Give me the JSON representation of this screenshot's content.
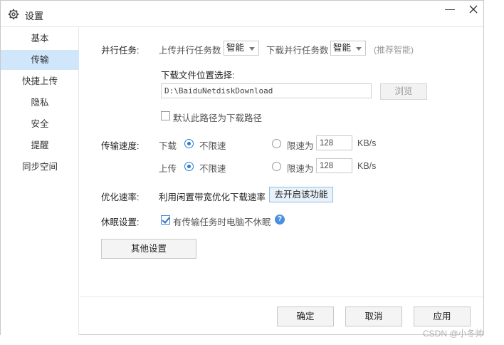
{
  "window": {
    "title": "设置"
  },
  "sidebar": {
    "items": [
      {
        "label": "基本"
      },
      {
        "label": "传输",
        "active": true
      },
      {
        "label": "快捷上传"
      },
      {
        "label": "隐私"
      },
      {
        "label": "安全"
      },
      {
        "label": "提醒"
      },
      {
        "label": "同步空间"
      }
    ]
  },
  "parallel": {
    "label": "并行任务:",
    "upload_label": "上传并行任务数",
    "upload_value": "智能",
    "download_label": "下载并行任务数",
    "download_value": "智能",
    "hint": "(推荐智能)"
  },
  "download_location": {
    "label": "下载文件位置选择:",
    "path": "D:\\BaiduNetdiskDownload",
    "browse_label": "浏览",
    "default_checkbox_label": "默认此路径为下载路径",
    "default_checked": false
  },
  "speed": {
    "label": "传输速度:",
    "download": {
      "label": "下载",
      "unlimited_label": "不限速",
      "limit_label": "限速为",
      "limit_value": "128",
      "unit": "KB/s",
      "mode": "unlimited"
    },
    "upload": {
      "label": "上传",
      "unlimited_label": "不限速",
      "limit_label": "限速为",
      "limit_value": "128",
      "unit": "KB/s",
      "mode": "unlimited"
    }
  },
  "optimize": {
    "label": "优化速率:",
    "description": "利用闲置带宽优化下载速率",
    "button_label": "去开启该功能"
  },
  "sleep": {
    "label": "休眠设置:",
    "checkbox_label": "有传输任务时电脑不休眠",
    "checked": true
  },
  "other_settings_label": "其他设置",
  "footer": {
    "ok_label": "确定",
    "cancel_label": "取消",
    "apply_label": "应用"
  },
  "watermark": "CSDN @小冬帅",
  "icons": {
    "title": "gear-icon",
    "close": "close-icon",
    "minimize": "minimize-icon",
    "help": "question-icon",
    "caret": "chevron-down-icon"
  },
  "colors": {
    "accent": "#2a7bd4",
    "sidebar_active": "#cfe6fb",
    "help_icon": "#4a90e2"
  }
}
